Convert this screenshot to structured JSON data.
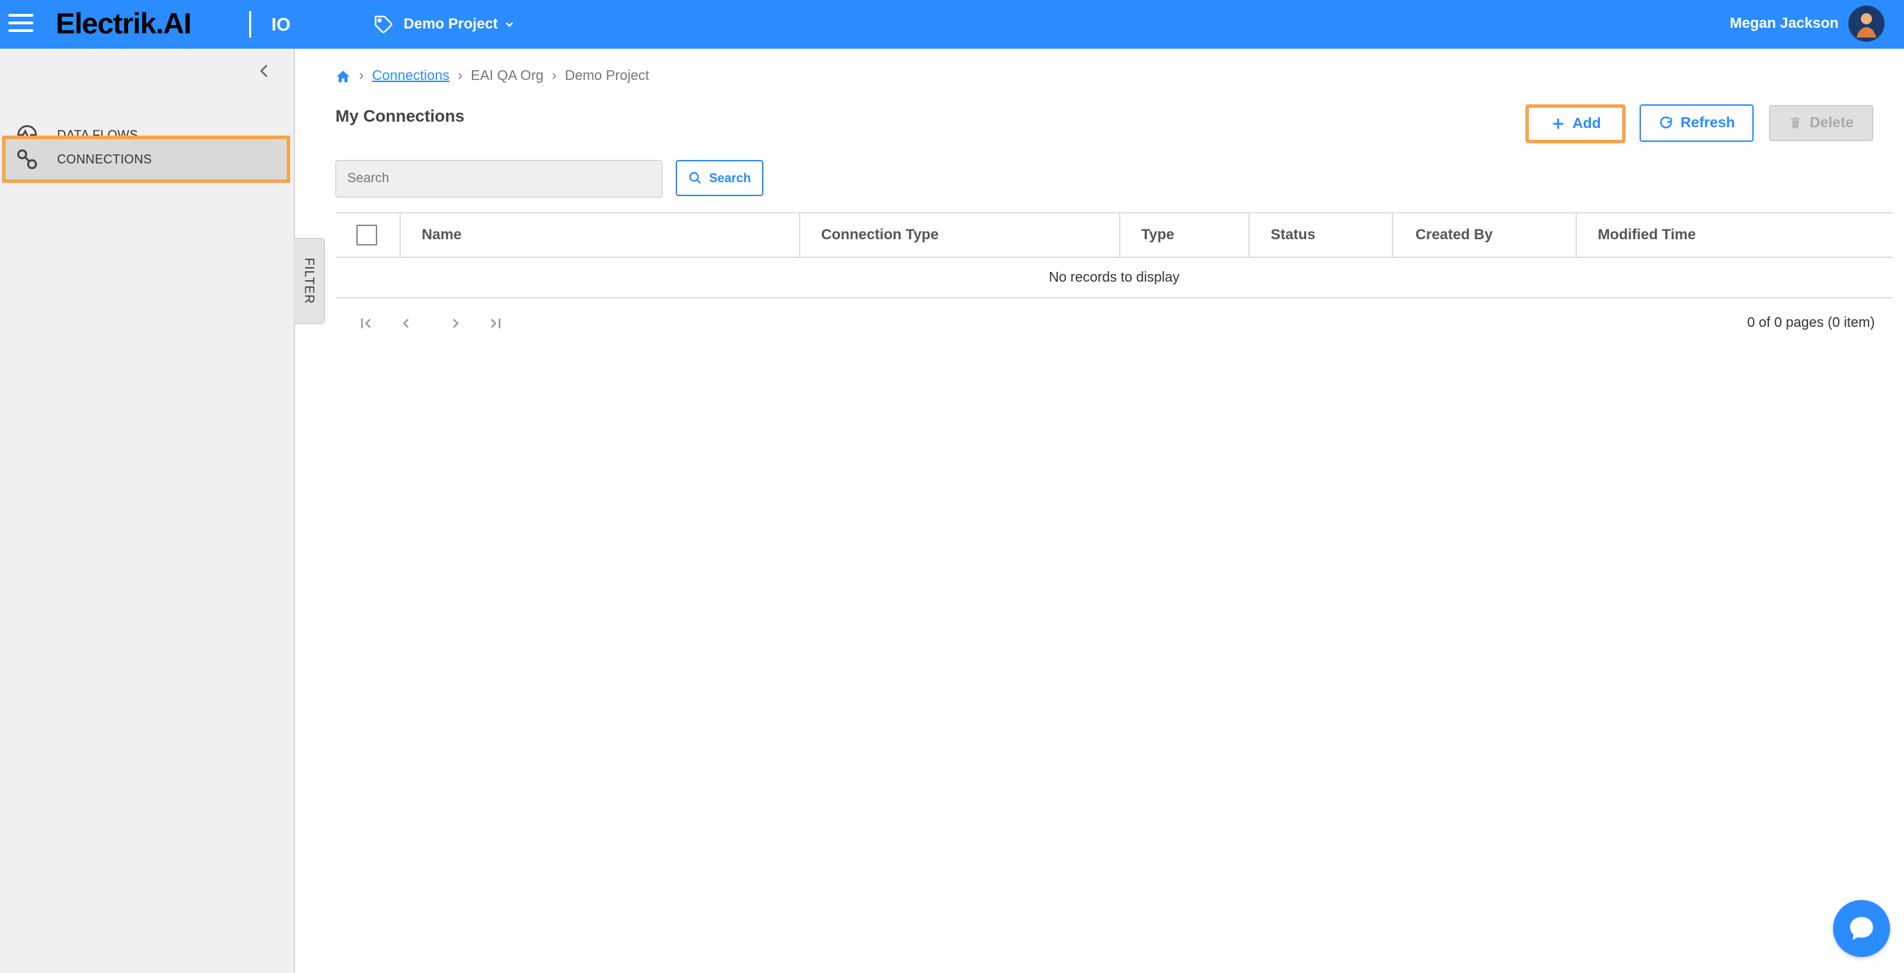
{
  "topbar": {
    "logo": "Electrik.AI",
    "app_code": "IO",
    "project_name": "Demo Project",
    "user_name": "Megan Jackson"
  },
  "sidebar": {
    "items": [
      {
        "label": "DATA FLOWS",
        "icon": "activity-icon"
      },
      {
        "label": "CONNECTIONS",
        "icon": "link-icon",
        "active": true
      }
    ],
    "filter_tab": "FILTER"
  },
  "breadcrumb": {
    "home_icon": "home-icon",
    "items": [
      "Connections",
      "EAI QA Org",
      "Demo Project"
    ]
  },
  "page": {
    "title": "My Connections"
  },
  "toolbar": {
    "add_label": "Add",
    "refresh_label": "Refresh",
    "delete_label": "Delete"
  },
  "search": {
    "placeholder": "Search",
    "value": "",
    "button_label": "Search"
  },
  "table": {
    "columns": [
      "Name",
      "Connection Type",
      "Type",
      "Status",
      "Created By",
      "Modified Time"
    ],
    "rows": [],
    "empty_message": "No records to display"
  },
  "pager": {
    "info": "0 of 0 pages (0 item)"
  },
  "colors": {
    "accent": "#2b8cff",
    "highlight": "#f6a44c"
  }
}
